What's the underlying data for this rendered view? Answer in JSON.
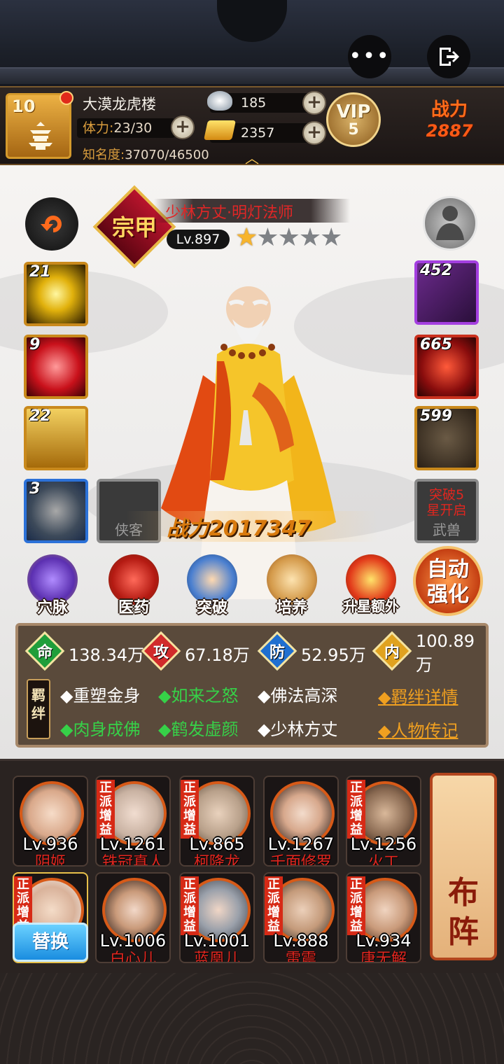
{
  "header": {
    "level": "10",
    "player_name": "大漠龙虎楼",
    "stamina_label": "体力:",
    "stamina_value": "23/30",
    "fame_label": "知名度:",
    "fame_value": "37070/46500",
    "silver": "185",
    "gold": "2357",
    "vip_label": "VIP",
    "vip_level": "5",
    "power_label": "战力",
    "power_value": "2887"
  },
  "hero": {
    "badge": "宗甲",
    "name": "少林方丈·明灯法师",
    "level": "Lv.897",
    "stars_filled": 1,
    "stars_total": 5,
    "power_label": "战力",
    "power_value": "2017347"
  },
  "left_slots": [
    {
      "num": "21",
      "icon": "golden-orb-skill-icon"
    },
    {
      "num": "9",
      "icon": "red-palm-skill-icon"
    },
    {
      "num": "22",
      "icon": "scripture-skill-icon"
    },
    {
      "num": "3",
      "icon": "fist-medallion-icon"
    },
    {
      "caption": "侠客"
    }
  ],
  "right_slots": [
    {
      "num": "452",
      "icon": "gauntlet-icon"
    },
    {
      "num": "665",
      "icon": "red-armor-icon"
    },
    {
      "num": "599",
      "icon": "gems-icon"
    },
    {
      "text1": "突破5",
      "text2": "星开启",
      "caption": "武兽"
    }
  ],
  "functions": [
    {
      "label": "穴脉",
      "icon": "meridian-icon"
    },
    {
      "label": "医药",
      "icon": "medicine-icon"
    },
    {
      "label": "突破",
      "icon": "breakthrough-icon"
    },
    {
      "label": "培养",
      "icon": "scroll-icon"
    },
    {
      "label": "升星额外",
      "icon": "star-upgrade-icon"
    }
  ],
  "auto_button": [
    "自动",
    "强化"
  ],
  "stats": [
    {
      "key": "命",
      "value": "138.34万",
      "color": "#1f9e3a"
    },
    {
      "key": "攻",
      "value": "67.18万",
      "color": "#d12b2b"
    },
    {
      "key": "防",
      "value": "52.95万",
      "color": "#1f6fd0"
    },
    {
      "key": "内",
      "value": "100.89万",
      "color": "#e0a21f"
    }
  ],
  "bond_tag": "羁绊",
  "bonds": [
    {
      "text": "◆重塑金身",
      "active": false
    },
    {
      "text": "◆如来之怒",
      "active": true
    },
    {
      "text": "◆佛法高深",
      "active": false
    },
    {
      "text": "◆肉身成佛",
      "active": true
    },
    {
      "text": "◆鹤发虚颜",
      "active": true
    },
    {
      "text": "◆少林方丈",
      "active": false
    }
  ],
  "links": {
    "bond_detail": "◆羁绊详情",
    "biography": "◆人物传记"
  },
  "roster": [
    {
      "level": "Lv.936",
      "name": "阴姬",
      "boost": false
    },
    {
      "level": "Lv.1261",
      "name": "铁冠真人",
      "boost": true
    },
    {
      "level": "Lv.865",
      "name": "柯降龙",
      "boost": true
    },
    {
      "level": "Lv.1267",
      "name": "千面修罗",
      "boost": false
    },
    {
      "level": "Lv.1256",
      "name": "火工",
      "boost": true
    },
    {
      "level": "",
      "name": "",
      "boost": true
    },
    {
      "level": "Lv.1006",
      "name": "白心儿",
      "boost": false
    },
    {
      "level": "Lv.1001",
      "name": "蓝凰儿",
      "boost": true
    },
    {
      "level": "Lv.888",
      "name": "雷震",
      "boost": true
    },
    {
      "level": "Lv.934",
      "name": "唐无解",
      "boost": true
    }
  ],
  "boost_label": "正派增益",
  "swap_label": "替换",
  "formation_label": [
    "布",
    "阵"
  ]
}
